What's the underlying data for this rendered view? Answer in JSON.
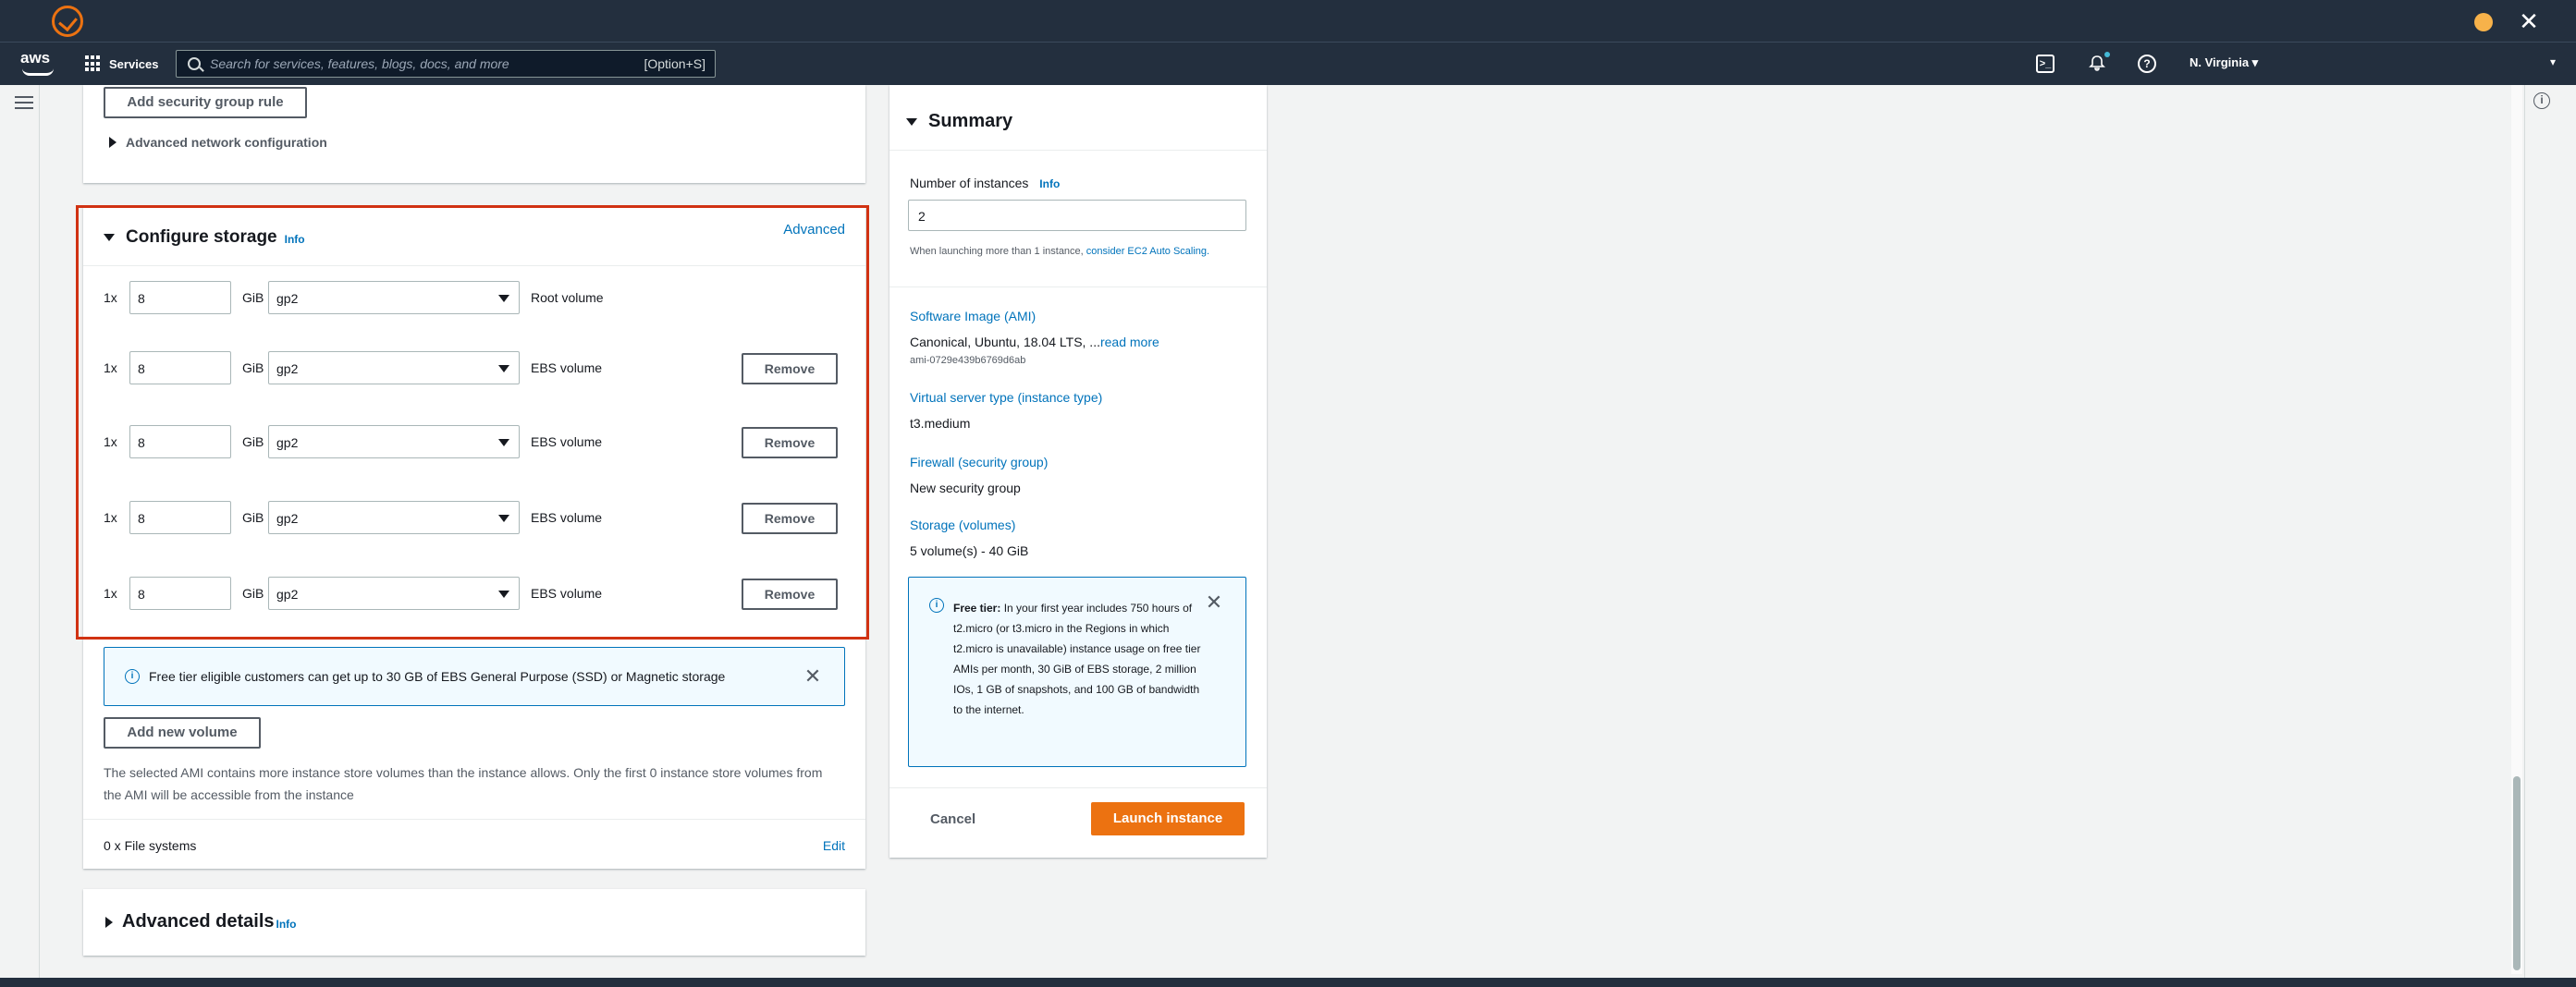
{
  "window": {
    "logo": "app-logo",
    "close": "✕"
  },
  "nav": {
    "brand": "aws",
    "services": "Services",
    "search_placeholder": "Search for services, features, blogs, docs, and more",
    "search_shortcut": "[Option+S]",
    "region": "N. Virginia ▾",
    "account_caret": "▾",
    "cloudshell": ">_",
    "help": "?",
    "bell": "🔔"
  },
  "network": {
    "add_rule_label": "Add security group rule",
    "advanced_network": "Advanced network configuration"
  },
  "storage": {
    "title": "Configure storage",
    "info": "Info",
    "advanced": "Advanced",
    "volumes": [
      {
        "mult": "1x",
        "size": "8",
        "unit": "GiB",
        "type": "gp2",
        "label": "Root volume",
        "removable": false
      },
      {
        "mult": "1x",
        "size": "8",
        "unit": "GiB",
        "type": "gp2",
        "label": "EBS volume",
        "removable": true
      },
      {
        "mult": "1x",
        "size": "8",
        "unit": "GiB",
        "type": "gp2",
        "label": "EBS volume",
        "removable": true
      },
      {
        "mult": "1x",
        "size": "8",
        "unit": "GiB",
        "type": "gp2",
        "label": "EBS volume",
        "removable": true
      },
      {
        "mult": "1x",
        "size": "8",
        "unit": "GiB",
        "type": "gp2",
        "label": "EBS volume",
        "removable": true
      }
    ],
    "remove_label": "Remove",
    "free_tier_alert": "Free tier eligible customers can get up to 30 GB of EBS General Purpose (SSD) or Magnetic storage",
    "add_volume": "Add new volume",
    "ami_note": "The selected AMI contains more instance store volumes than the instance allows. Only the first 0 instance store volumes from the AMI will be accessible from the instance",
    "file_systems": "0 x File systems",
    "edit": "Edit"
  },
  "advanced_details": {
    "title": "Advanced details",
    "info": "Info"
  },
  "summary": {
    "title": "Summary",
    "num_instances_label": "Number of instances",
    "info": "Info",
    "num_instances_value": "2",
    "asg_note_prefix": "When launching more than 1 instance, ",
    "asg_note_link": "consider EC2 Auto Scaling.",
    "ami_label": "Software Image (AMI)",
    "ami_value": "Canonical, Ubuntu, 18.04 LTS, ...",
    "read_more": "read more",
    "ami_id": "ami-0729e439b6769d6ab",
    "instance_type_label": "Virtual server type (instance type)",
    "instance_type_value": "t3.medium",
    "firewall_label": "Firewall (security group)",
    "firewall_value": "New security group",
    "storage_label": "Storage (volumes)",
    "storage_value": "5 volume(s) - 40 GiB",
    "free_tier_bold": "Free tier:",
    "free_tier_text": " In your first year includes 750 hours of t2.micro (or t3.micro in the Regions in which t2.micro is unavailable) instance usage on free tier AMIs per month, 30 GiB of EBS storage, 2 million IOs, 1 GB of snapshots, and 100 GB of bandwidth to the internet.",
    "cancel": "Cancel",
    "launch": "Launch instance"
  },
  "colors": {
    "accent": "#ec7211",
    "link": "#0073bb",
    "highlight": "#d13212",
    "navbar": "#232f3e"
  }
}
